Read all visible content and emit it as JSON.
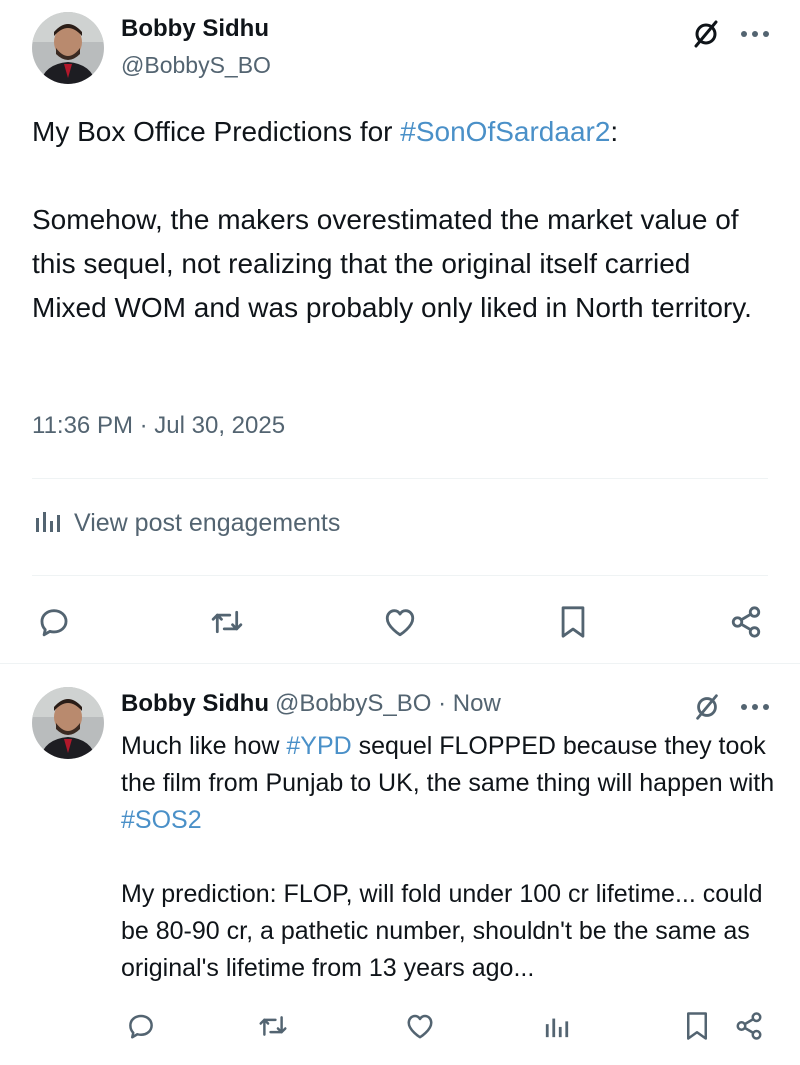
{
  "post": {
    "author_name": "Bobby Sidhu",
    "author_handle": "@BobbyS_BO",
    "text_prefix": "My Box Office Predictions for ",
    "hashtag": "#SonOfSardaar2",
    "text_suffix": ":",
    "paragraph_2": "Somehow, the makers overestimated the market value of this sequel, not realizing that the original itself carried Mixed WOM and was probably only liked in North territory.",
    "timestamp": "11:36 PM · Jul 30, 2025",
    "engagements_label": "View post engagements",
    "icons": [
      "grok-icon",
      "more-icon",
      "reply-icon",
      "repost-icon",
      "like-icon",
      "bookmark-icon",
      "share-icon",
      "analytics-icon"
    ]
  },
  "reply": {
    "author_name": "Bobby Sidhu",
    "meta": "@BobbyS_BO · Now",
    "line1_prefix": "Much like how ",
    "hashtag1": "#YPD",
    "line1_suffix": " sequel FLOPPED because they took the film from Punjab to UK, the same thing will happen with ",
    "hashtag2": "#SOS2",
    "paragraph_2": "My prediction: FLOP, will fold under 100 cr lifetime... could be 80-90 cr, a pathetic number, shouldn't be the same as original's lifetime from 13 years ago...",
    "icons": [
      "reply-icon",
      "repost-icon",
      "like-icon",
      "views-icon",
      "bookmark-icon",
      "share-icon"
    ]
  },
  "colors": {
    "text": "#0f1419",
    "secondary": "#536471",
    "hashtag": "#4a90c8",
    "divider": "#eff3f4"
  }
}
